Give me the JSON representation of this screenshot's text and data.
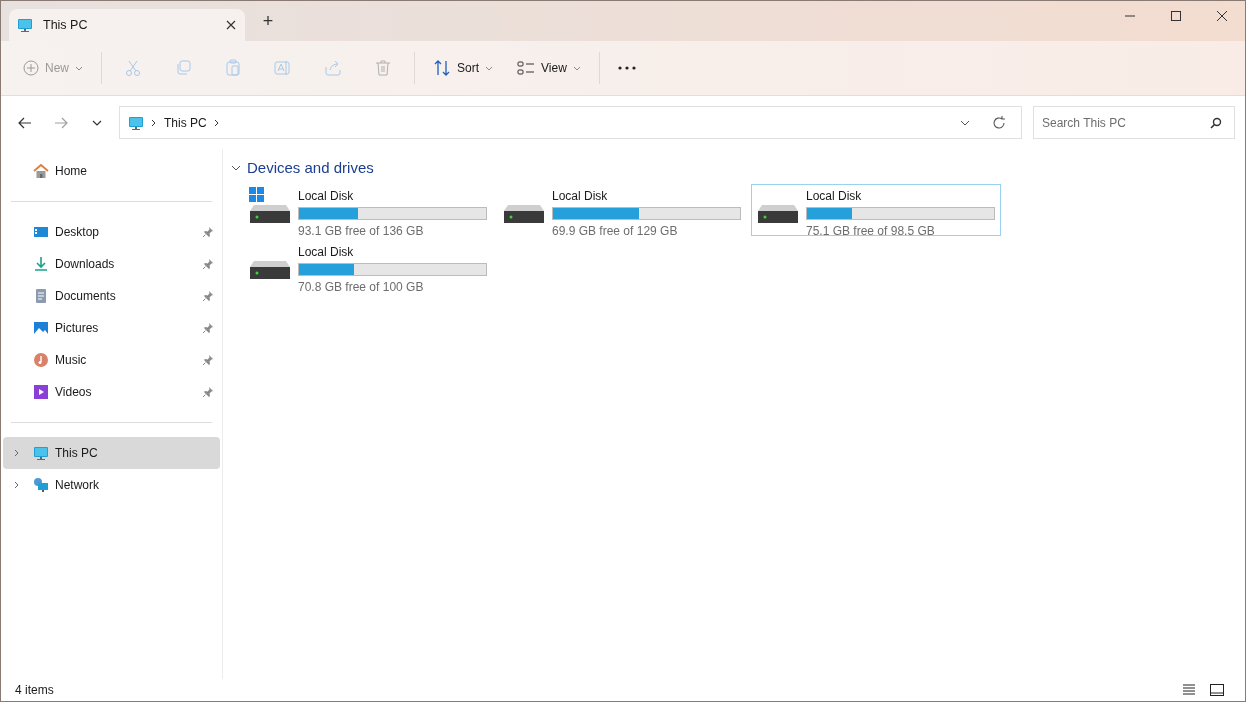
{
  "tab": {
    "title": "This PC",
    "new_tab": "+"
  },
  "toolbar": [
    {
      "kind": "menu",
      "label": "New",
      "disabled": true
    },
    {
      "kind": "icon",
      "disabled": true
    },
    {
      "kind": "icon",
      "disabled": true
    },
    {
      "kind": "icon",
      "disabled": true
    },
    {
      "kind": "icon",
      "disabled": true
    },
    {
      "kind": "icon",
      "disabled": true
    },
    {
      "kind": "icon",
      "disabled": true
    },
    {
      "kind": "menu",
      "label": "Sort",
      "disabled": false
    },
    {
      "kind": "menu",
      "label": "View",
      "disabled": false
    },
    {
      "kind": "more",
      "disabled": false
    }
  ],
  "address": {
    "path": "This PC",
    "forward_disabled": true
  },
  "search": {
    "placeholder": "Search This PC"
  },
  "sidebar": {
    "groups": [
      [
        {
          "label": "Home",
          "pinned": false,
          "selected": false,
          "expandable": false
        }
      ],
      [
        {
          "label": "Desktop",
          "pinned": true,
          "selected": false,
          "expandable": false
        },
        {
          "label": "Downloads",
          "pinned": true,
          "selected": false,
          "expandable": false
        },
        {
          "label": "Documents",
          "pinned": true,
          "selected": false,
          "expandable": false
        },
        {
          "label": "Pictures",
          "pinned": true,
          "selected": false,
          "expandable": false
        },
        {
          "label": "Music",
          "pinned": true,
          "selected": false,
          "expandable": false
        },
        {
          "label": "Videos",
          "pinned": true,
          "selected": false,
          "expandable": false
        }
      ],
      [
        {
          "label": "This PC",
          "pinned": false,
          "selected": true,
          "expandable": true
        },
        {
          "label": "Network",
          "pinned": false,
          "selected": false,
          "expandable": true
        }
      ]
    ]
  },
  "section": {
    "title": "Devices and drives",
    "expanded": true
  },
  "drives": [
    {
      "kind": "system",
      "name": "Local Disk",
      "level": 0.315,
      "free": "93.1 GB free of 136 GB",
      "selected": false
    },
    {
      "kind": "disk",
      "name": "Local Disk",
      "level": 0.458,
      "free": "69.9 GB free of 129 GB",
      "selected": false
    },
    {
      "kind": "disk",
      "name": "Local Disk",
      "level": 0.238,
      "free": "75.1 GB free of 98.5 GB",
      "selected": true
    },
    {
      "kind": "disk",
      "name": "Local Disk",
      "level": 0.292,
      "free": "70.8 GB free of 100 GB",
      "selected": false
    }
  ],
  "status_bar": {
    "count": "4 items"
  }
}
